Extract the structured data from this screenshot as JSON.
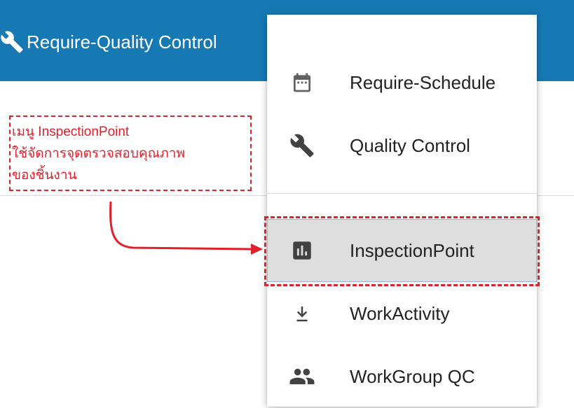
{
  "header": {
    "title": "Require-Quality Control",
    "icon": "wrench-icon",
    "background": "#1679b4"
  },
  "annotation": {
    "lines": [
      "เมนู InspectionPoint",
      "ใช้จัดการจุดตรวจสอบคุณภาพ",
      "ของชิ้นงาน"
    ],
    "color": "#e0202b"
  },
  "menu": {
    "items": [
      {
        "label": "Require-Schedule",
        "icon": "calendar-icon",
        "selected": false
      },
      {
        "label": "Quality Control",
        "icon": "wrench-icon",
        "selected": false
      },
      {
        "label": "InspectionPoint",
        "icon": "bar-chart-icon",
        "selected": true
      },
      {
        "label": "WorkActivity",
        "icon": "download-icon",
        "selected": false
      },
      {
        "label": "WorkGroup QC",
        "icon": "group-icon",
        "selected": false
      }
    ]
  }
}
